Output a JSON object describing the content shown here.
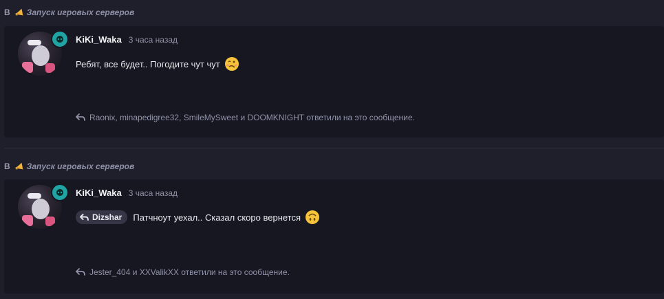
{
  "posts": [
    {
      "channel_prefix": "В",
      "channel": "Запуск игровых серверов",
      "author": "KiKi_Waka",
      "time": "3 часа назад",
      "reply_to": "",
      "text": "Ребят, все будет.. Погодите чут чут",
      "emoji": "woozy-face",
      "replies_text": "Raonix, minapedigree32, SmileMySweet и DOOMKNIGHT ответили на это сообщение."
    },
    {
      "channel_prefix": "В",
      "channel": "Запуск игровых серверов",
      "author": "KiKi_Waka",
      "time": "3 часа назад",
      "reply_to": "Dizshar",
      "text": "Патчноут уехал.. Сказал скоро вернется",
      "emoji": "upside-down-face",
      "replies_text": "Jester_404 и XXValikXX ответили на это сообщение."
    }
  ],
  "colors": {
    "background": "#1e1f2b",
    "card": "#161720",
    "muted": "#8f92a8",
    "badge": "#1fa3a3"
  }
}
